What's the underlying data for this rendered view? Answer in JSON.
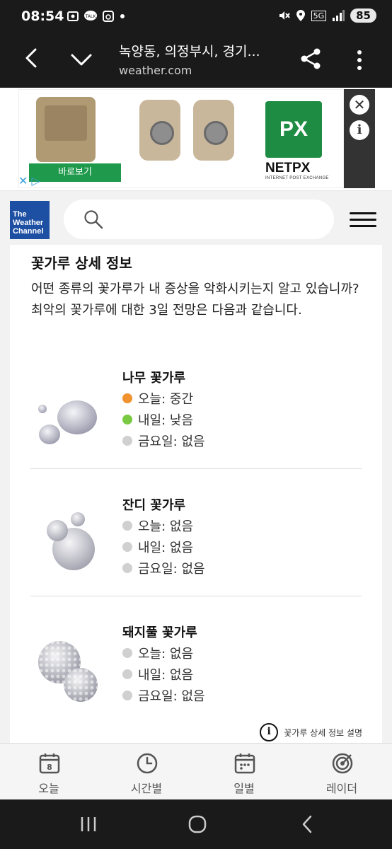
{
  "status_bar": {
    "time": "08:54",
    "left_icons": [
      "screenshot-icon",
      "kakaotalk-icon",
      "timer-icon",
      "dot-icon"
    ],
    "network": "5G",
    "battery": "85"
  },
  "browser": {
    "title": "녹양동, 의정부시, 경기...",
    "url": "weather.com"
  },
  "ad": {
    "cta_label": "바로보기",
    "logo_text": "PX",
    "brand": "NETPX",
    "brand_sub": "INTERNET POST EXCHANGE",
    "close_label": "✕",
    "info_label": "i"
  },
  "site": {
    "logo_line1": "The",
    "logo_line2": "Weather",
    "logo_line3": "Channel"
  },
  "pollen_section": {
    "title": "꽃가루 상세 정보",
    "description": "어떤 종류의 꽃가루가 내 증상을 악화시키는지 알고 있습니까? 최악의 꽃가루에 대한 3일 전망은 다음과 같습니다.",
    "types": [
      {
        "name": "나무 꽃가루",
        "days": [
          {
            "label": "오늘: 중간",
            "color": "#f0922e"
          },
          {
            "label": "내일: 낮음",
            "color": "#7ac943"
          },
          {
            "label": "금요일: 없음",
            "color": "#d0d0d0"
          }
        ]
      },
      {
        "name": "잔디 꽃가루",
        "days": [
          {
            "label": "오늘: 없음",
            "color": "#d0d0d0"
          },
          {
            "label": "내일: 없음",
            "color": "#d0d0d0"
          },
          {
            "label": "금요일: 없음",
            "color": "#d0d0d0"
          }
        ]
      },
      {
        "name": "돼지풀 꽃가루",
        "days": [
          {
            "label": "오늘: 없음",
            "color": "#d0d0d0"
          },
          {
            "label": "내일: 없음",
            "color": "#d0d0d0"
          },
          {
            "label": "금요일: 없음",
            "color": "#d0d0d0"
          }
        ]
      }
    ],
    "footer_link": "꽃가루 상세 정보 설명"
  },
  "bottom_nav": {
    "items": [
      {
        "label": "오늘",
        "icon": "calendar-day-icon"
      },
      {
        "label": "시간별",
        "icon": "clock-icon"
      },
      {
        "label": "일별",
        "icon": "calendar-icon"
      },
      {
        "label": "레이더",
        "icon": "radar-icon"
      }
    ],
    "today_day": "8"
  }
}
